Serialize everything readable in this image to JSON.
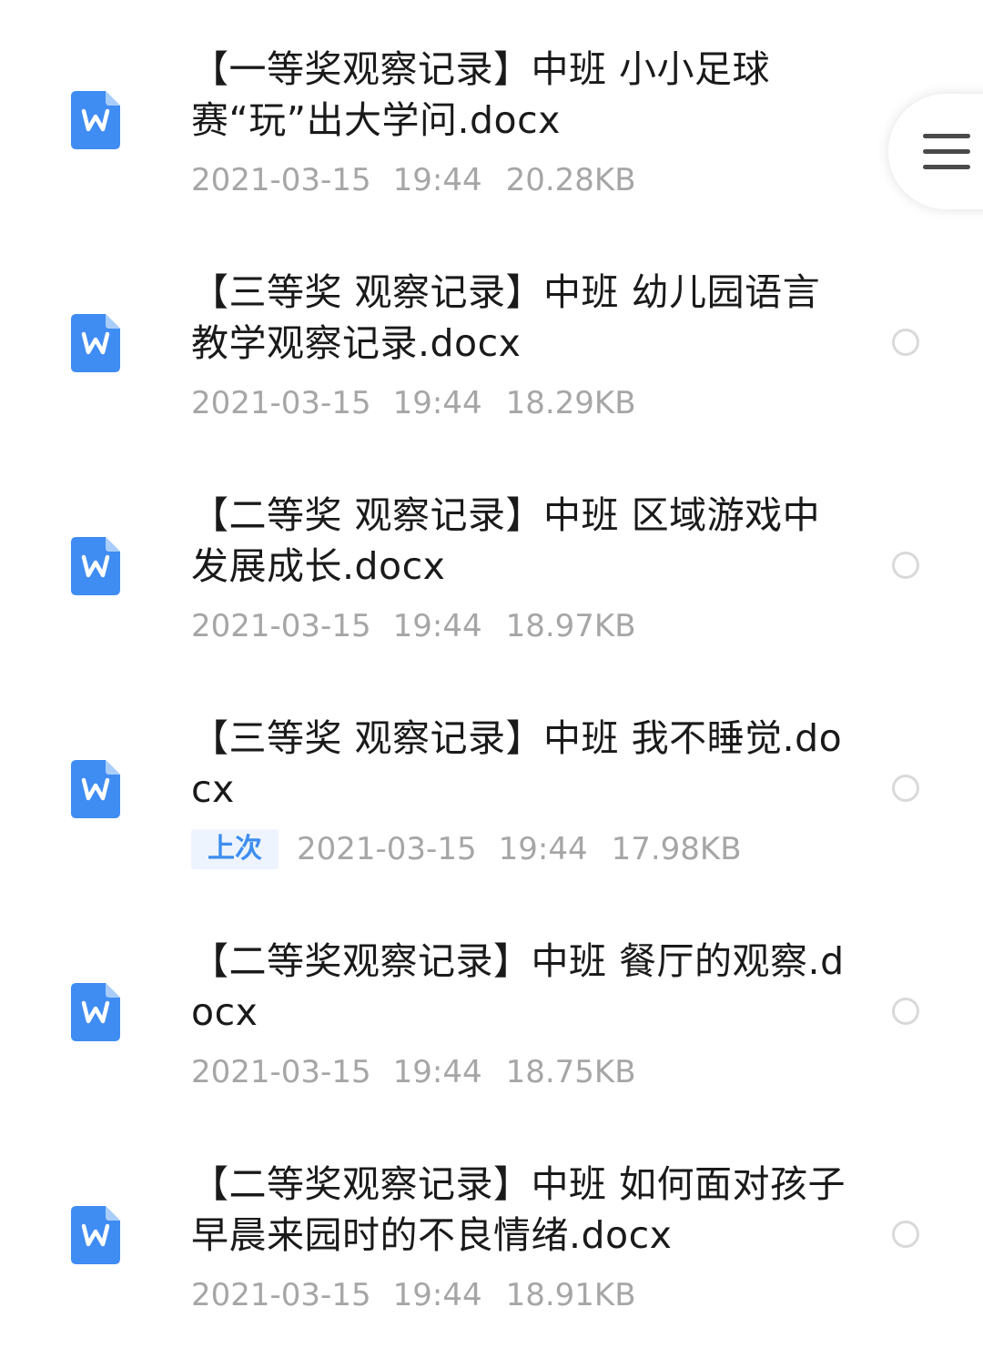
{
  "files": [
    {
      "icon": "word-doc-icon",
      "name": "【一等奖观察记录】中班 小小足球赛“玩”出大学问.docx",
      "date": "2021-03-15",
      "time": "19:44",
      "size": "20.28KB"
    },
    {
      "icon": "word-doc-icon",
      "name": "【三等奖 观察记录】中班 幼儿园语言教学观察记录.docx",
      "date": "2021-03-15",
      "time": "19:44",
      "size": "18.29KB"
    },
    {
      "icon": "word-doc-icon",
      "name": "【二等奖 观察记录】中班 区域游戏中发展成长.docx",
      "date": "2021-03-15",
      "time": "19:44",
      "size": "18.97KB"
    },
    {
      "icon": "word-doc-icon",
      "name": "【三等奖 观察记录】中班 我不睡觉.docx",
      "tag": "上次",
      "date": "2021-03-15",
      "time": "19:44",
      "size": "17.98KB"
    },
    {
      "icon": "word-doc-icon",
      "name": "【二等奖观察记录】中班 餐厅的观察.docx",
      "date": "2021-03-15",
      "time": "19:44",
      "size": "18.75KB"
    },
    {
      "icon": "word-doc-icon",
      "name": "【二等奖观察记录】中班 如何面对孩子早晨来园时的不良情绪.docx",
      "date": "2021-03-15",
      "time": "19:44",
      "size": "18.91KB"
    }
  ],
  "floating_menu": {
    "icon": "menu-icon"
  },
  "colors": {
    "accent": "#3d8ef0",
    "doc_icon": "#3f8cf3",
    "text_primary": "#1a1a1a",
    "text_secondary": "#a6a6a6"
  }
}
